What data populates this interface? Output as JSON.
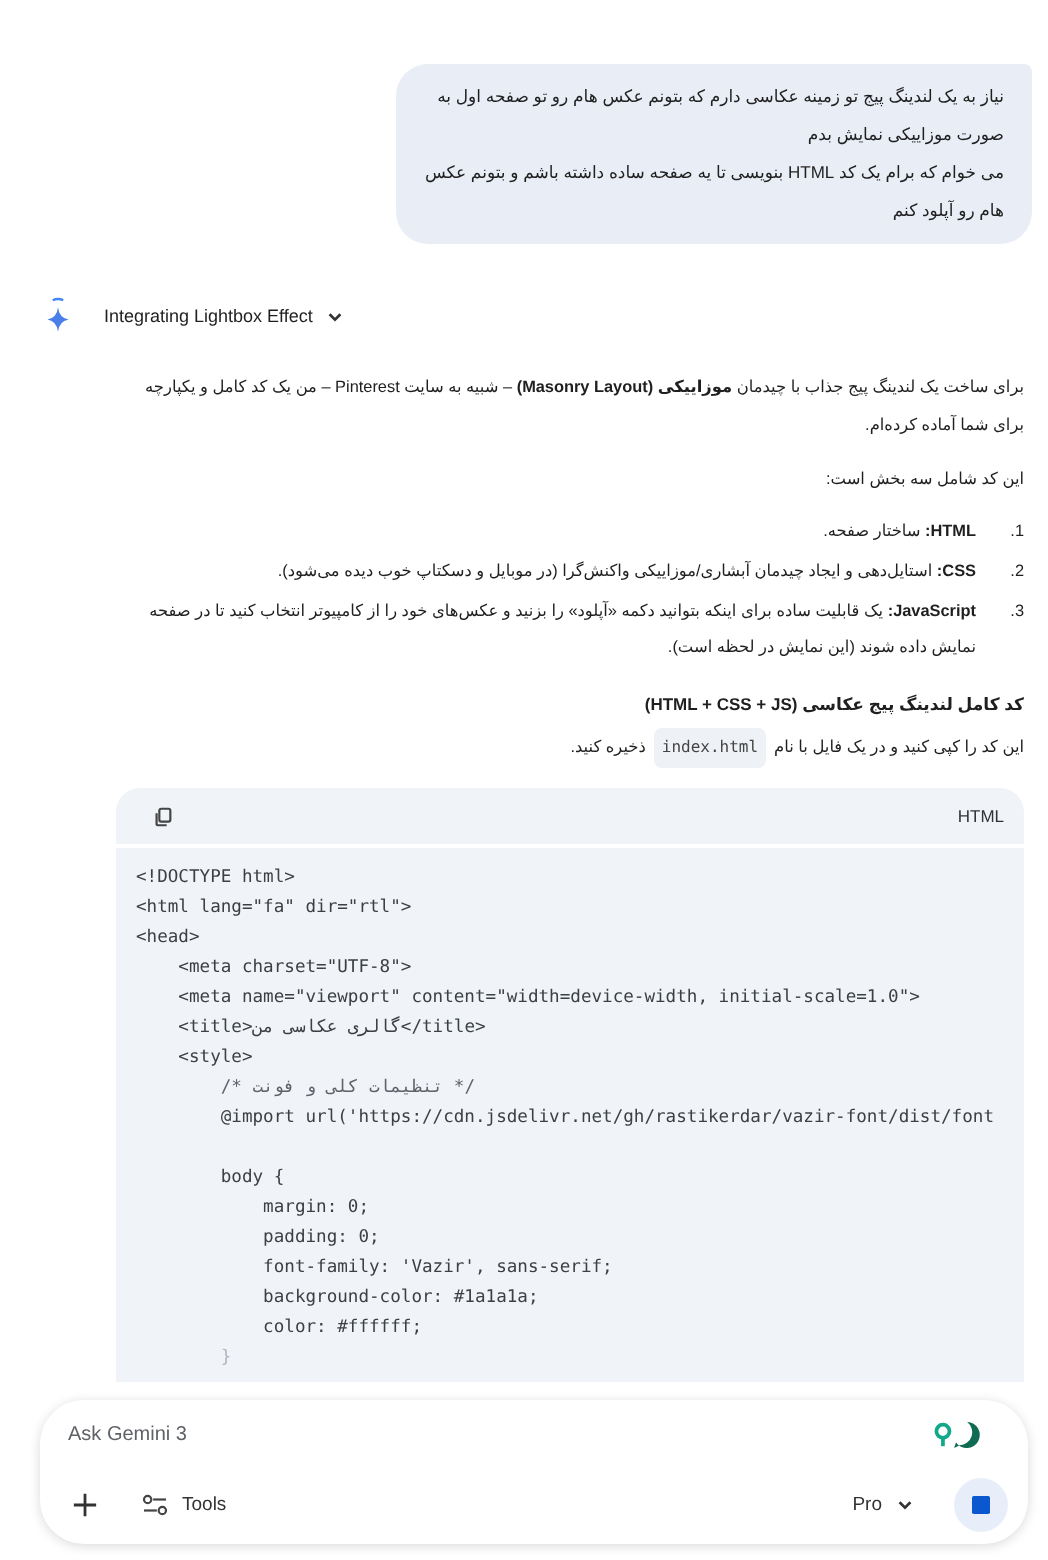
{
  "user_message": {
    "paragraphs": [
      "نیاز به یک لندینگ پیج تو زمینه عکاسی دارم که بتونم عکس هام رو تو صفحه اول به صورت موزاییکی نمایش بدم",
      "می خوام که برام یک کد HTML بنویسی تا یه صفحه ساده داشته باشم و بتونم عکس هام رو آپلود کنم"
    ]
  },
  "thinking": {
    "label": "Integrating Lightbox Effect",
    "expanded": false
  },
  "response": {
    "intro": "برای ساخت یک لندینگ پیج جذاب با چیدمان **موزاییکی (Masonry Layout)** – شبیه به سایت Pinterest – من یک کد کامل و یکپارچه برای شما آماده کرده‌ام.",
    "lead": "این کد شامل سه بخش است:",
    "items": [
      {
        "number": "1.",
        "text": "**HTML:** ساختار صفحه."
      },
      {
        "number": "2.",
        "text": "**CSS:** استایل‌دهی و ایجاد چیدمان آبشاری/موزاییکی واکنش‌گرا (در موبایل و دسکتاپ خوب دیده می‌شود)."
      },
      {
        "number": "3.",
        "text": "**JavaScript:** یک قابلیت ساده برای اینکه بتوانید دکمه «آپلود» را بزنید و عکس‌های خود را از کامپیوتر انتخاب کنید تا در صفحه نمایش داده شوند (این نمایش در لحظه است)."
      }
    ],
    "heading": "کد کامل لندینگ پیج عکاسی (HTML + CSS + JS)",
    "instruction": {
      "before": "این کد را کپی کنید و در یک فایل با نام",
      "code": "index.html",
      "after": "ذخیره کنید."
    }
  },
  "code_block": {
    "language": "HTML",
    "lines": [
      {
        "kind": "code",
        "text": "<!DOCTYPE html>"
      },
      {
        "kind": "code",
        "text": "<html lang=\"fa\" dir=\"rtl\">"
      },
      {
        "kind": "code",
        "text": "<head>"
      },
      {
        "kind": "code",
        "text": "    <meta charset=\"UTF-8\">"
      },
      {
        "kind": "code",
        "text": "    <meta name=\"viewport\" content=\"width=device-width, initial-scale=1.0\">"
      },
      {
        "kind": "code",
        "text": "    <title>گالری عکاسی من</title>"
      },
      {
        "kind": "code",
        "text": "    <style>"
      },
      {
        "kind": "comment",
        "text": "        /* تنظیمات کلی و فونت */"
      },
      {
        "kind": "code",
        "text": "        @import url('https://cdn.jsdelivr.net/gh/rastikerdar/vazir-font/dist/font"
      },
      {
        "kind": "code",
        "gap_before": true,
        "text": "        body {"
      },
      {
        "kind": "code",
        "text": "            margin: 0;"
      },
      {
        "kind": "code",
        "text": "            padding: 0;"
      },
      {
        "kind": "code",
        "text": "            font-family: 'Vazir', sans-serif;"
      },
      {
        "kind": "code",
        "text": "            background-color: #1a1a1a;"
      },
      {
        "kind": "code",
        "text": "            color: #ffffff;"
      },
      {
        "kind": "faded",
        "text": "        }"
      }
    ]
  },
  "composer": {
    "placeholder": "Ask Gemini 3",
    "tools_label": "Tools",
    "model": "Pro"
  }
}
